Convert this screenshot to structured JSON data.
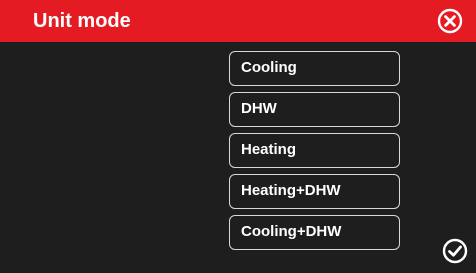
{
  "header": {
    "title": "Unit mode",
    "close_icon": "close-circle-icon"
  },
  "options": [
    {
      "label": "Cooling"
    },
    {
      "label": "DHW"
    },
    {
      "label": "Heating"
    },
    {
      "label": "Heating+DHW"
    },
    {
      "label": "Cooling+DHW"
    }
  ],
  "footer": {
    "confirm_icon": "check-circle-icon"
  },
  "colors": {
    "header_bg": "#e51b23",
    "body_bg": "#1e1e1e",
    "text": "#ffffff",
    "option_border": "#d8d8d8"
  }
}
